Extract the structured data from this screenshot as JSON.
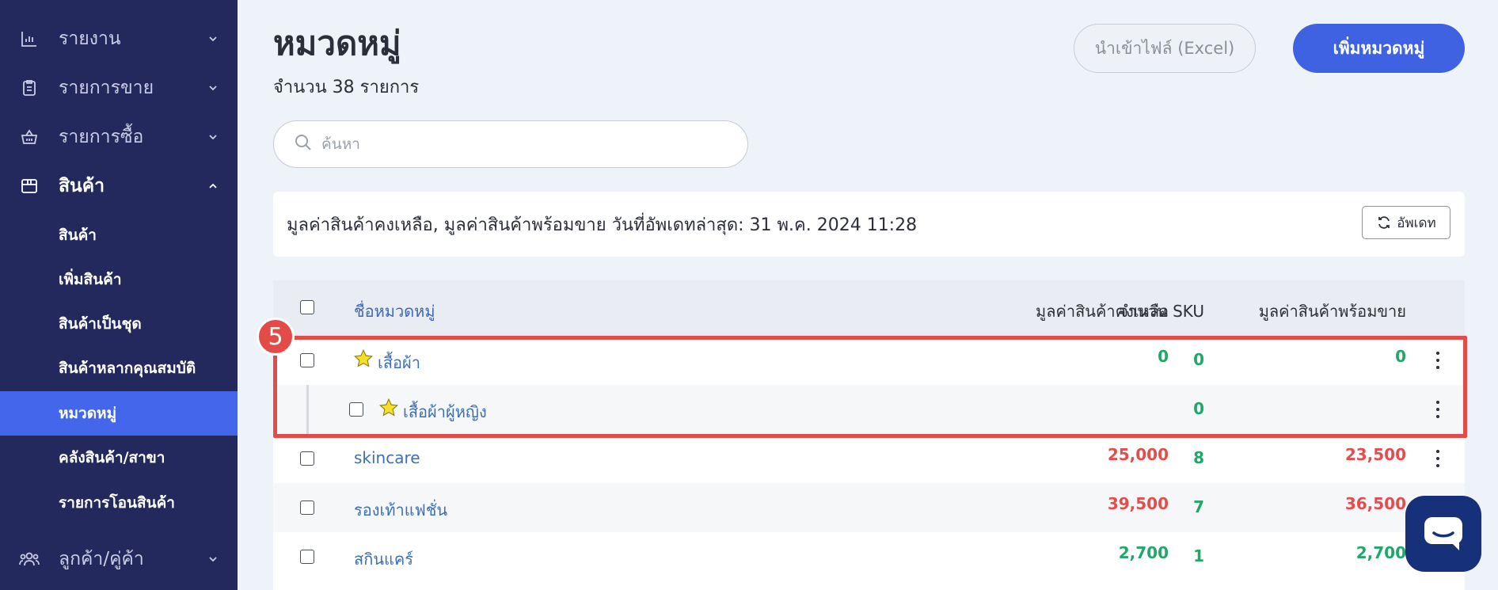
{
  "sidebar": {
    "items": [
      {
        "label": "รายงาน",
        "icon": "bar-chart-icon"
      },
      {
        "label": "รายการขาย",
        "icon": "clipboard-icon"
      },
      {
        "label": "รายการซื้อ",
        "icon": "basket-icon"
      },
      {
        "label": "สินค้า",
        "icon": "box-icon"
      },
      {
        "label": "ลูกค้า/คู่ค้า",
        "icon": "users-icon"
      }
    ],
    "sub_items": [
      {
        "label": "สินค้า"
      },
      {
        "label": "เพิ่มสินค้า"
      },
      {
        "label": "สินค้าเป็นชุด"
      },
      {
        "label": "สินค้าหลากคุณสมบัติ"
      },
      {
        "label": "หมวดหมู่",
        "active": true
      },
      {
        "label": "คลังสินค้า/สาขา"
      },
      {
        "label": "รายการโอนสินค้า"
      }
    ]
  },
  "header": {
    "title": "หมวดหมู่",
    "count": "จำนวน 38 รายการ",
    "import_label": "นำเข้าไฟล์ (Excel)",
    "add_label": "เพิ่มหมวดหมู่"
  },
  "search": {
    "placeholder": "ค้นหา"
  },
  "update": {
    "text": "มูลค่าสินค้าคงเหลือ, มูลค่าสินค้าพร้อมขาย วันที่อัพเดทล่าสุด: 31 พ.ค. 2024 11:28",
    "refresh_label": "อัพเดท"
  },
  "table": {
    "headers": [
      "ชื่อหมวดหมู่",
      "จำนวน SKU",
      "มูลค่าสินค้าคงเหลือ",
      "มูลค่าสินค้าพร้อมขาย"
    ],
    "rows": [
      {
        "name": "เสื้อผ้า",
        "sku": "0",
        "stock_value": "0",
        "ready_value": "0"
      },
      {
        "name": "เสื้อผ้าผู้หญิง",
        "sku": "0",
        "stock_value": "",
        "ready_value": ""
      },
      {
        "name": "skincare",
        "sku": "8",
        "stock_value": "25,000",
        "ready_value": "23,500"
      },
      {
        "name": "รองเท้าแฟชั่น",
        "sku": "7",
        "stock_value": "39,500",
        "ready_value": "36,500"
      },
      {
        "name": "สกินแคร์",
        "sku": "1",
        "stock_value": "2,700",
        "ready_value": "2,700"
      }
    ]
  },
  "annotation": {
    "badge": "5",
    "color": "#e24b47"
  },
  "colors": {
    "sidebar_bg": "#23295c",
    "accent": "#4466ea",
    "green": "#20a86a",
    "red": "#e74c4c"
  }
}
